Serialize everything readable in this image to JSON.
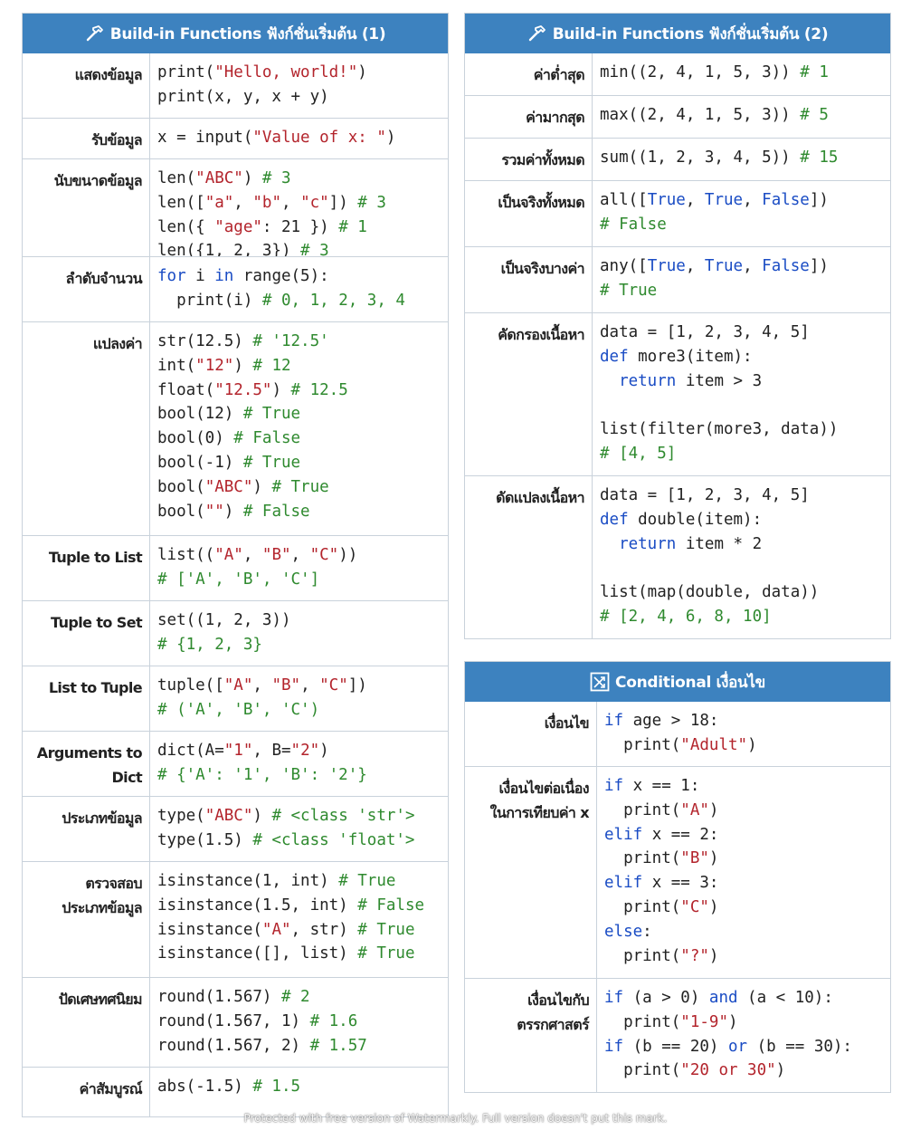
{
  "colors": {
    "header_bg": "#3d82bf",
    "keyword": "#1a4cc4",
    "string": "#b3242c",
    "comment": "#2f8a2f"
  },
  "panels": [
    {
      "id": "builtin-1",
      "icon": "hammer-icon",
      "title": "Build-in Functions ฟังก์ชั่นเริ่มต้น (1)",
      "rows": [
        {
          "label": "แสดงข้อมูล",
          "lines": [
            "print(\"Hello, world!\")",
            "print(x, y, x + y)"
          ]
        },
        {
          "label": "รับข้อมูล",
          "lines": [
            "x = input(\"Value of x: \")"
          ]
        },
        {
          "label": "นับขนาดข้อมูล",
          "lines": [
            "len(\"ABC\") # 3",
            "len([\"a\", \"b\", \"c\"]) # 3",
            "len({ \"age\": 21 }) # 1",
            "len({1, 2, 3}) # 3"
          ]
        },
        {
          "label": "ลำดับจำนวน",
          "lines": [
            "for i in range(5):",
            "  print(i) # 0, 1, 2, 3, 4"
          ]
        },
        {
          "label": "แปลงค่า",
          "lines": [
            "str(12.5) # '12.5'",
            "int(\"12\") # 12",
            "float(\"12.5\") # 12.5",
            "bool(12) # True",
            "bool(0) # False",
            "bool(-1) # True",
            "bool(\"ABC\") # True",
            "bool(\"\") # False"
          ]
        },
        {
          "label": "Tuple to List",
          "lines": [
            "list((\"A\", \"B\", \"C\"))",
            "# ['A', 'B', 'C']"
          ]
        },
        {
          "label": "Tuple to Set",
          "lines": [
            "set((1, 2, 3))",
            "# {1, 2, 3}"
          ]
        },
        {
          "label": "List to Tuple",
          "lines": [
            "tuple([\"A\", \"B\", \"C\"])",
            "# ('A', 'B', 'C')"
          ]
        },
        {
          "label": "Arguments to\nDict",
          "lines": [
            "dict(A=\"1\", B=\"2\")",
            "# {'A': '1', 'B': '2'}"
          ]
        },
        {
          "label": "ประเภทข้อมูล",
          "lines": [
            "type(\"ABC\") # <class 'str'>",
            "type(1.5) # <class 'float'>"
          ]
        },
        {
          "label": "ตรวจสอบ\nประเภทข้อมูล",
          "lines": [
            "isinstance(1, int) # True",
            "isinstance(1.5, int) # False",
            "isinstance(\"A\", str) # True",
            "isinstance([], list) # True"
          ]
        },
        {
          "label": "ปัดเศษทศนิยม",
          "lines": [
            "round(1.567) # 2",
            "round(1.567, 1) # 1.6",
            "round(1.567, 2) # 1.57"
          ]
        },
        {
          "label": "ค่าสัมบูรณ์",
          "lines": [
            "abs(-1.5) # 1.5"
          ]
        }
      ]
    },
    {
      "id": "builtin-2",
      "icon": "hammer-icon",
      "title": "Build-in Functions ฟังก์ชั่นเริ่มต้น (2)",
      "rows": [
        {
          "label": "ค่าต่ำสุด",
          "lines": [
            "min((2, 4, 1, 5, 3)) # 1"
          ]
        },
        {
          "label": "ค่ามากสุด",
          "lines": [
            "max((2, 4, 1, 5, 3)) # 5"
          ]
        },
        {
          "label": "รวมค่าทั้งหมด",
          "lines": [
            "sum((1, 2, 3, 4, 5)) # 15"
          ]
        },
        {
          "label": "เป็นจริงทั้งหมด",
          "lines": [
            "all([True, True, False])",
            "# False"
          ]
        },
        {
          "label": "เป็นจริงบางค่า",
          "lines": [
            "any([True, True, False])",
            "# True"
          ]
        },
        {
          "label": "คัดกรองเนื้อหา",
          "lines": [
            "data = [1, 2, 3, 4, 5]",
            "def more3(item):",
            "  return item > 3",
            "",
            "list(filter(more3, data))",
            "# [4, 5]"
          ]
        },
        {
          "label": "ดัดแปลงเนื้อหา",
          "lines": [
            "data = [1, 2, 3, 4, 5]",
            "def double(item):",
            "  return item * 2",
            "",
            "list(map(double, data))",
            "# [2, 4, 6, 8, 10]"
          ]
        }
      ]
    },
    {
      "id": "conditional",
      "icon": "shuffle-icon",
      "title": "Conditional เงื่อนไข",
      "rows": [
        {
          "label": "เงื่อนไข",
          "lines": [
            "if age > 18:",
            "  print(\"Adult\")"
          ]
        },
        {
          "label": "เงื่อนไขต่อเนื่อง\nในการเทียบค่า x",
          "lines": [
            "if x == 1:",
            "  print(\"A\")",
            "elif x == 2:",
            "  print(\"B\")",
            "elif x == 3:",
            "  print(\"C\")",
            "else:",
            "  print(\"?\")"
          ]
        },
        {
          "label": "เงื่อนไขกับ\nตรรกศาสตร์",
          "lines": [
            "if (a > 0) and (a < 10):",
            "  print(\"1-9\")",
            "if (b == 20) or (b == 30):",
            "  print(\"20 or 30\")"
          ]
        }
      ]
    }
  ],
  "watermark": "Protected with free version of Watermarkly. Full version doesn't put this mark."
}
